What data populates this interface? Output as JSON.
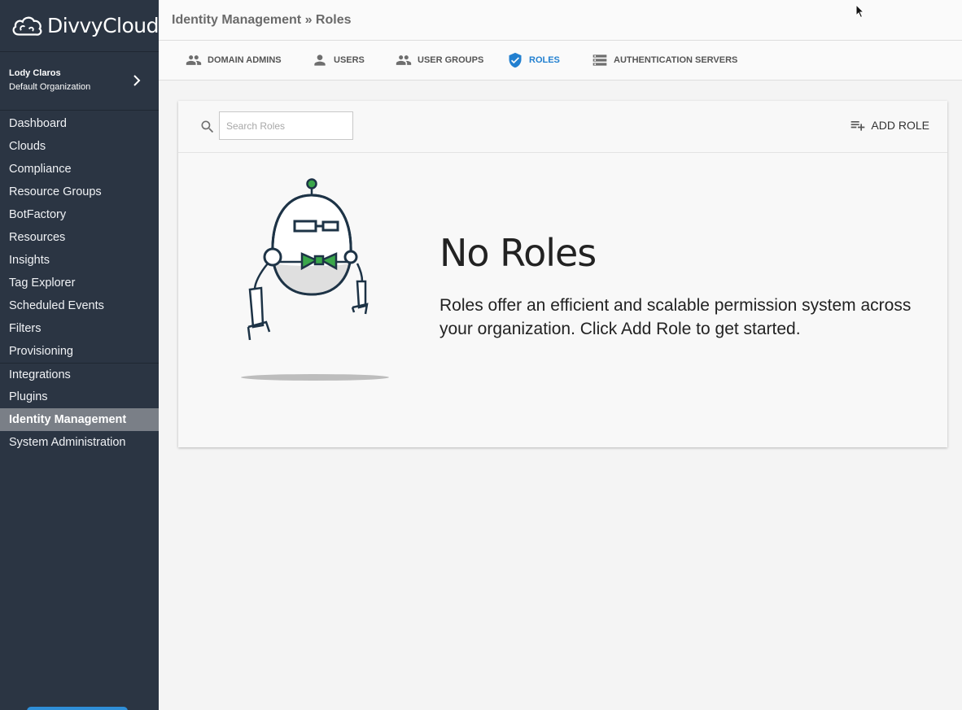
{
  "app": {
    "logo_text": "DivvyCloud"
  },
  "org": {
    "user": "Lody Claros",
    "name": "Default Organization"
  },
  "nav": {
    "items": [
      {
        "label": "Dashboard"
      },
      {
        "label": "Clouds"
      },
      {
        "label": "Compliance"
      },
      {
        "label": "Resource Groups"
      },
      {
        "label": "BotFactory"
      },
      {
        "label": "Resources"
      },
      {
        "label": "Insights"
      },
      {
        "label": "Tag Explorer"
      },
      {
        "label": "Scheduled Events"
      },
      {
        "label": "Filters"
      },
      {
        "label": "Provisioning"
      },
      {
        "label": "Integrations"
      },
      {
        "label": "Plugins"
      },
      {
        "label": "Identity Management",
        "active": true
      },
      {
        "label": "System Administration"
      }
    ]
  },
  "header": {
    "breadcrumb": "Identity Management » Roles"
  },
  "tabs": [
    {
      "label": "DOMAIN ADMINS",
      "icon": "people-icon"
    },
    {
      "label": "USERS",
      "icon": "person-icon"
    },
    {
      "label": "USER GROUPS",
      "icon": "people-icon"
    },
    {
      "label": "ROLES",
      "icon": "shield-check-icon",
      "active": true
    },
    {
      "label": "AUTHENTICATION SERVERS",
      "icon": "server-icon"
    }
  ],
  "toolbar": {
    "search_placeholder": "Search Roles",
    "add_label": "ADD ROLE"
  },
  "empty_state": {
    "title": "No Roles",
    "text": "Roles offer an efficient and scalable permission system across your organization. Click Add Role to get started."
  },
  "colors": {
    "sidebar": "#2b3543",
    "accent": "#2280d0",
    "robot_bowtie": "#3aa64a"
  }
}
